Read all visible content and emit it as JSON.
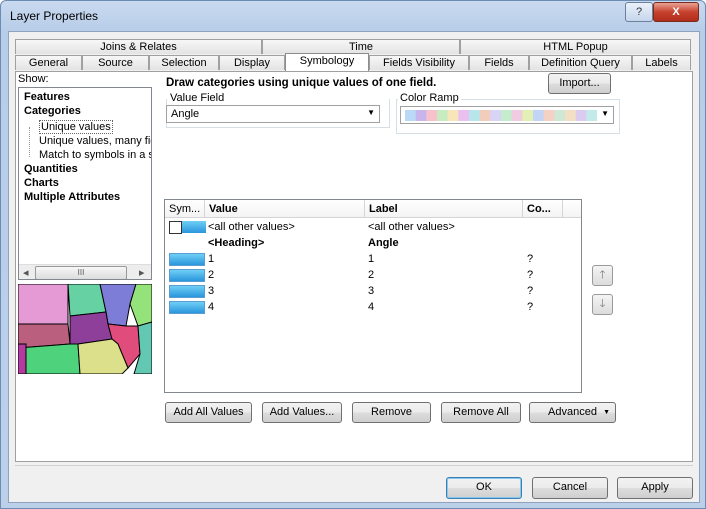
{
  "window": {
    "title": "Layer Properties",
    "help_label": "?",
    "close_label": "X"
  },
  "tabs_row1": [
    {
      "label": "Joins & Relates"
    },
    {
      "label": "Time"
    },
    {
      "label": "HTML Popup"
    }
  ],
  "tabs_row2": [
    {
      "label": "General"
    },
    {
      "label": "Source"
    },
    {
      "label": "Selection"
    },
    {
      "label": "Display"
    },
    {
      "label": "Symbology",
      "active": true
    },
    {
      "label": "Fields Visibility"
    },
    {
      "label": "Fields"
    },
    {
      "label": "Definition Query"
    },
    {
      "label": "Labels"
    }
  ],
  "show": {
    "label": "Show:",
    "items": [
      {
        "label": "Features",
        "bold": true
      },
      {
        "label": "Categories",
        "bold": true
      },
      {
        "label": "Unique values",
        "selected": true
      },
      {
        "label": "Unique values, many fiel"
      },
      {
        "label": "Match to symbols in a sty"
      },
      {
        "label": "Quantities",
        "bold": true
      },
      {
        "label": "Charts",
        "bold": true
      },
      {
        "label": "Multiple Attributes",
        "bold": true
      }
    ],
    "scroll_thumb": "III"
  },
  "symbology": {
    "heading": "Draw categories using unique values of one field.",
    "import_label": "Import...",
    "value_field_label": "Value Field",
    "value_field_value": "Angle",
    "color_ramp_label": "Color Ramp",
    "ramp_colors": [
      "#b9d9f5",
      "#c8b5ec",
      "#f7c2cc",
      "#c8ecc2",
      "#f8e5b9",
      "#e9c0ef",
      "#b6e6ea",
      "#f3cdbb",
      "#d8d4f5",
      "#c4eccd",
      "#f1cbe0",
      "#e3f0b5",
      "#c3d5f6",
      "#f5d0c4",
      "#cfe8d6",
      "#f3e0c4",
      "#dccbf0",
      "#c2eae9"
    ]
  },
  "table": {
    "headers": {
      "symbol": "Sym...",
      "value": "Value",
      "label": "Label",
      "count": "Co..."
    },
    "rows": [
      {
        "symbol": "empty",
        "value": "<all other values>",
        "label": "<all other values>",
        "count": ""
      },
      {
        "symbol": "none",
        "value": "<Heading>",
        "label": "Angle",
        "count": "",
        "bold": true
      },
      {
        "symbol": "ramp",
        "value": "1",
        "label": "1",
        "count": "?"
      },
      {
        "symbol": "ramp",
        "value": "2",
        "label": "2",
        "count": "?"
      },
      {
        "symbol": "ramp",
        "value": "3",
        "label": "3",
        "count": "?"
      },
      {
        "symbol": "ramp",
        "value": "4",
        "label": "4",
        "count": "?"
      }
    ],
    "move_up": "🡑",
    "move_down": "🡓"
  },
  "actions": {
    "add_all": "Add All Values",
    "add_values": "Add Values...",
    "remove": "Remove",
    "remove_all": "Remove All",
    "advanced": "Advanced"
  },
  "dialog": {
    "ok": "OK",
    "cancel": "Cancel",
    "apply": "Apply"
  }
}
